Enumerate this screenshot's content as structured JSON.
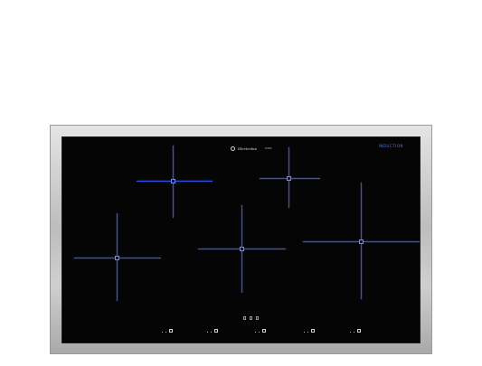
{
  "brand": {
    "name": "Electrolux",
    "model": "ICON"
  },
  "label": "INDUCTION",
  "colors": {
    "zone_lines": "#2f4fe0",
    "glass": "#050505",
    "frame": "#c8c8c8"
  },
  "zones": [
    "zone-rear-left",
    "zone-rear-center",
    "zone-front-left",
    "zone-center",
    "zone-right-bridge"
  ],
  "controls": [
    "control-1",
    "control-2",
    "control-3",
    "control-4",
    "control-5"
  ]
}
